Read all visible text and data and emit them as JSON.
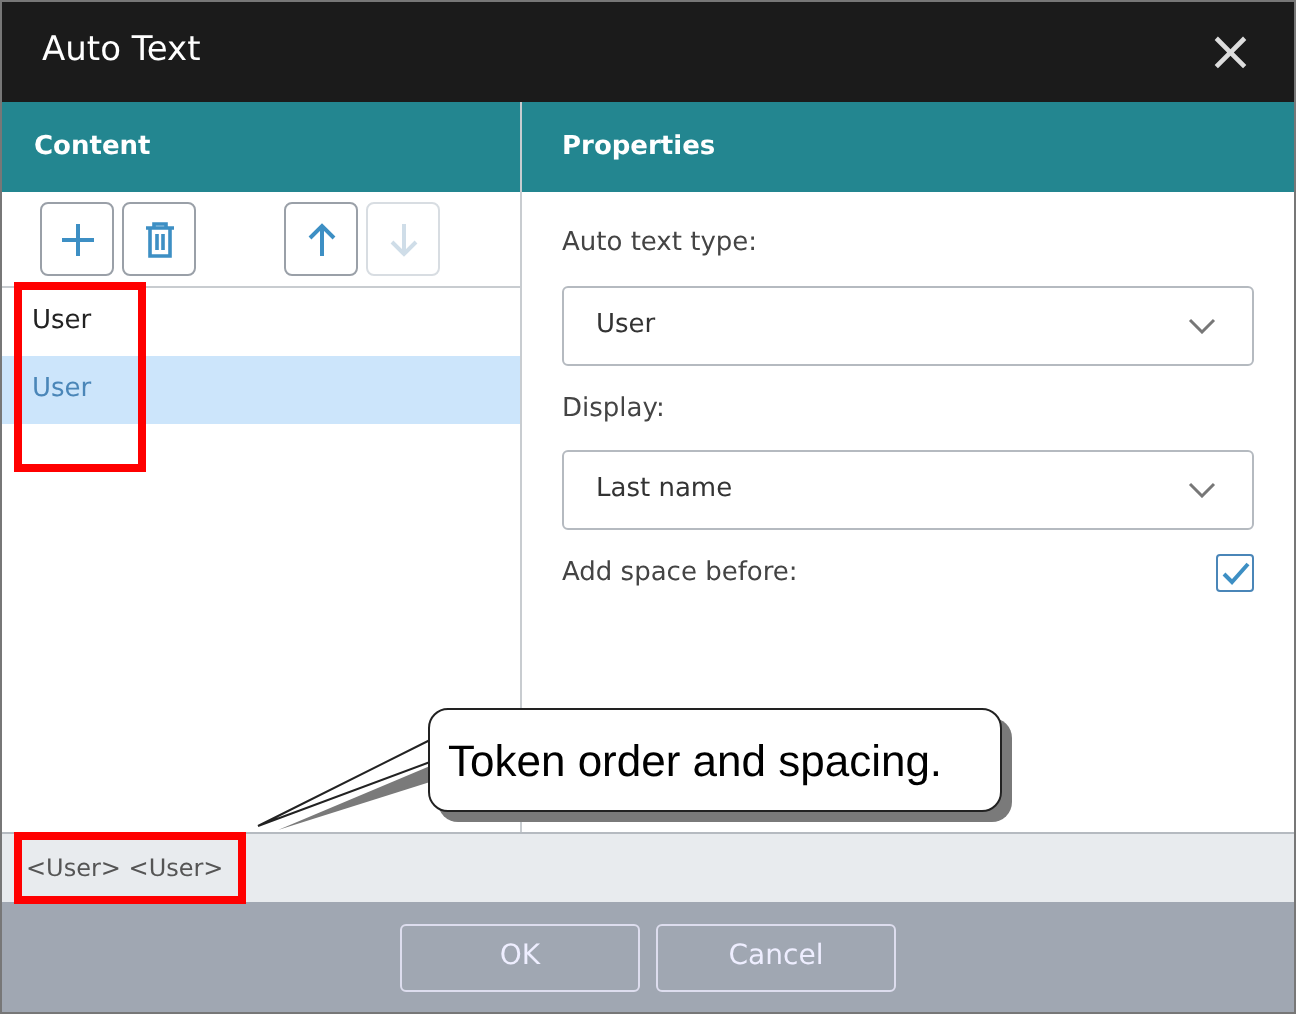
{
  "window": {
    "title": "Auto Text",
    "close": "×"
  },
  "content": {
    "header": "Content",
    "toolbar": [
      {
        "kind": "add",
        "disabled": false
      },
      {
        "kind": "delete",
        "disabled": false
      },
      {
        "kind": "up",
        "disabled": false
      },
      {
        "kind": "down",
        "disabled": true
      }
    ],
    "items": [
      {
        "label": "User",
        "selected": false
      },
      {
        "label": "User",
        "selected": true
      }
    ]
  },
  "properties": {
    "header": "Properties",
    "fields": [
      {
        "label": "Auto text type:",
        "value": "User"
      },
      {
        "label": "Display:",
        "value": "Last name"
      }
    ],
    "checkbox": {
      "label": "Add space before:",
      "checked": true
    }
  },
  "preview": "<User> <User>",
  "buttons": [
    "OK",
    "Cancel"
  ],
  "callout": "Token order and spacing."
}
